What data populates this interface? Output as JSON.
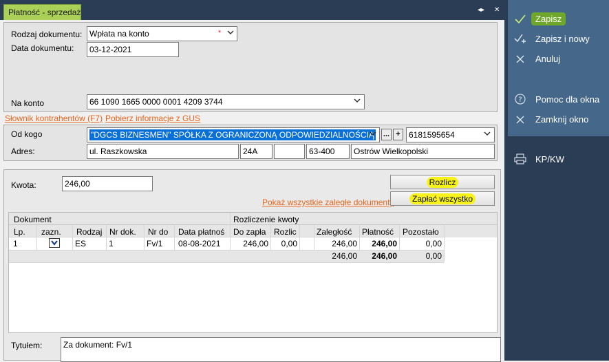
{
  "tab": {
    "title": "Płatność - sprzedaż",
    "controls": [
      "◂▸",
      "✕"
    ]
  },
  "top": {
    "rodzaj_label": "Rodzaj dokumentu:",
    "rodzaj_value": "Wpłata na konto",
    "required_mark": "*",
    "data_label": "Data dokumentu:",
    "data_value": "03-12-2021",
    "konto_label": "Na konto",
    "konto_value": "66 1090 1665 0000 0001 4209 3744"
  },
  "links": {
    "slownik": "Słownik kontrahentów (F7)",
    "gus": "Pobierz informacje z GUS"
  },
  "kontrahent": {
    "od_label": "Od kogo",
    "name": "\"DGCS BIZNESMEN\" SPÓŁKA Z OGRANICZONĄ ODPOWIEDZIALNOŚCIĄ",
    "dots": "...",
    "plus": "+",
    "nip": "6181595654",
    "adres_label": "Adres:",
    "ulica": "ul. Raszkowska",
    "nr_domu": "24A",
    "nr_lokalu": "",
    "kod": "63-400",
    "miasto": "Ostrów Wielkopolski"
  },
  "kwota": {
    "label": "Kwota:",
    "value": "246,00"
  },
  "buttons": {
    "rozlicz": "Rozlicz",
    "zaplac": "Zapłać wszystko"
  },
  "pokaz_link": "Pokaż wszystkie zaległe dokumenty",
  "grid": {
    "group_dokument": "Dokument",
    "group_rozliczenie": "Rozliczenie kwoty",
    "headers": [
      "Lp.",
      "zazn.",
      "Rodzaj",
      "Nr dok.",
      "Nr do",
      "Data płatnoś",
      "Do zapła",
      "Rozlic",
      "",
      "Zaległość",
      "Płatność",
      "Pozostało"
    ],
    "rows": [
      {
        "lp": "1",
        "rodzaj": "ES",
        "nr_dok": "1",
        "nr_do": "Fv/1",
        "data": "08-08-2021",
        "do_zaplaty": "246,00",
        "rozlic": "0,00",
        "zaleglosc": "246,00",
        "platnosc": "246,00",
        "pozostalo": "0,00"
      }
    ],
    "totals": {
      "zaleglosc": "246,00",
      "platnosc": "246,00",
      "pozostalo": "0,00"
    }
  },
  "tytulem": {
    "label": "Tytułem:",
    "value": "Za dokument: Fv/1"
  },
  "sidebar": {
    "zapisz": "Zapisz",
    "zapisz_nowy": "Zapisz i nowy",
    "anuluj": "Anuluj",
    "pomoc": "Pomoc dla okna",
    "zamknij": "Zamknij okno",
    "kpkw": "KP/KW"
  },
  "colors": {
    "sidebar_bg": "#2b3c55",
    "sidebar_active": "#45688a",
    "tab_green": "#aad058",
    "link_orange": "#e8651b",
    "highlight": "#f7f21a",
    "selection_blue": "#0a6fd6"
  }
}
